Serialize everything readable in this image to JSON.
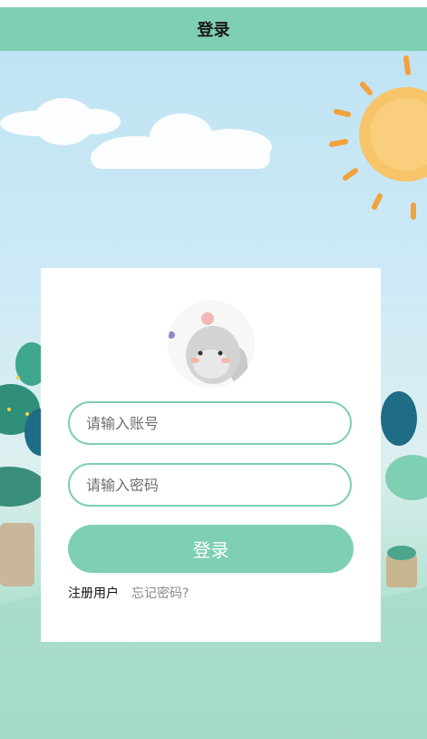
{
  "header": {
    "title": "登录"
  },
  "form": {
    "username_placeholder": "请输入账号",
    "password_placeholder": "请输入密码",
    "login_label": "登录",
    "register_label": "注册用户",
    "forgot_label": "忘记密码?"
  },
  "colors": {
    "accent": "#7fcfb2"
  }
}
